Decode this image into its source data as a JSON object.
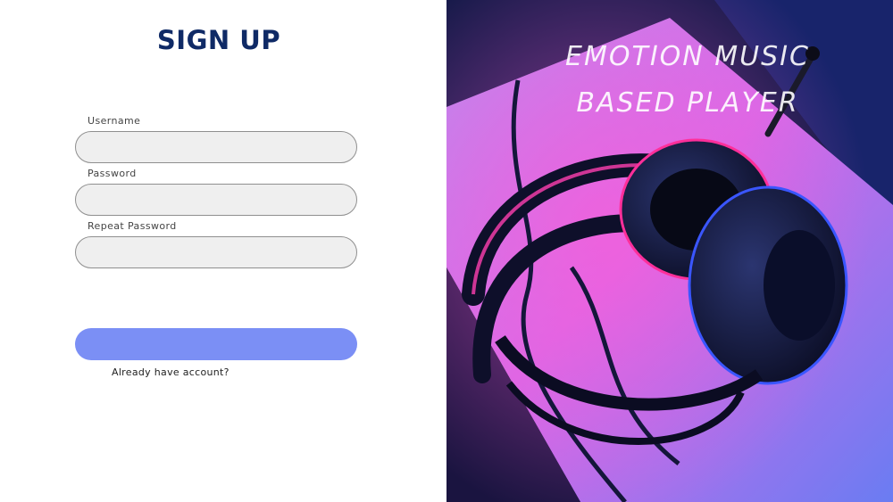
{
  "form": {
    "title": "SIGN UP",
    "fields": [
      {
        "label": "Username",
        "value": "",
        "placeholder": ""
      },
      {
        "label": "Password",
        "value": "",
        "placeholder": ""
      },
      {
        "label": "Repeat Password",
        "value": "",
        "placeholder": ""
      }
    ],
    "submit_label": "",
    "login_link": "Already have account?"
  },
  "hero": {
    "title_line1": "EMOTION MUSIC",
    "title_line2": "BASED PLAYER",
    "image": "headphones-photo"
  },
  "colors": {
    "title": "#0f2a66",
    "submit_button": "#7b8ff5",
    "field_background": "#efefef",
    "field_border": "#8f8f8f"
  }
}
